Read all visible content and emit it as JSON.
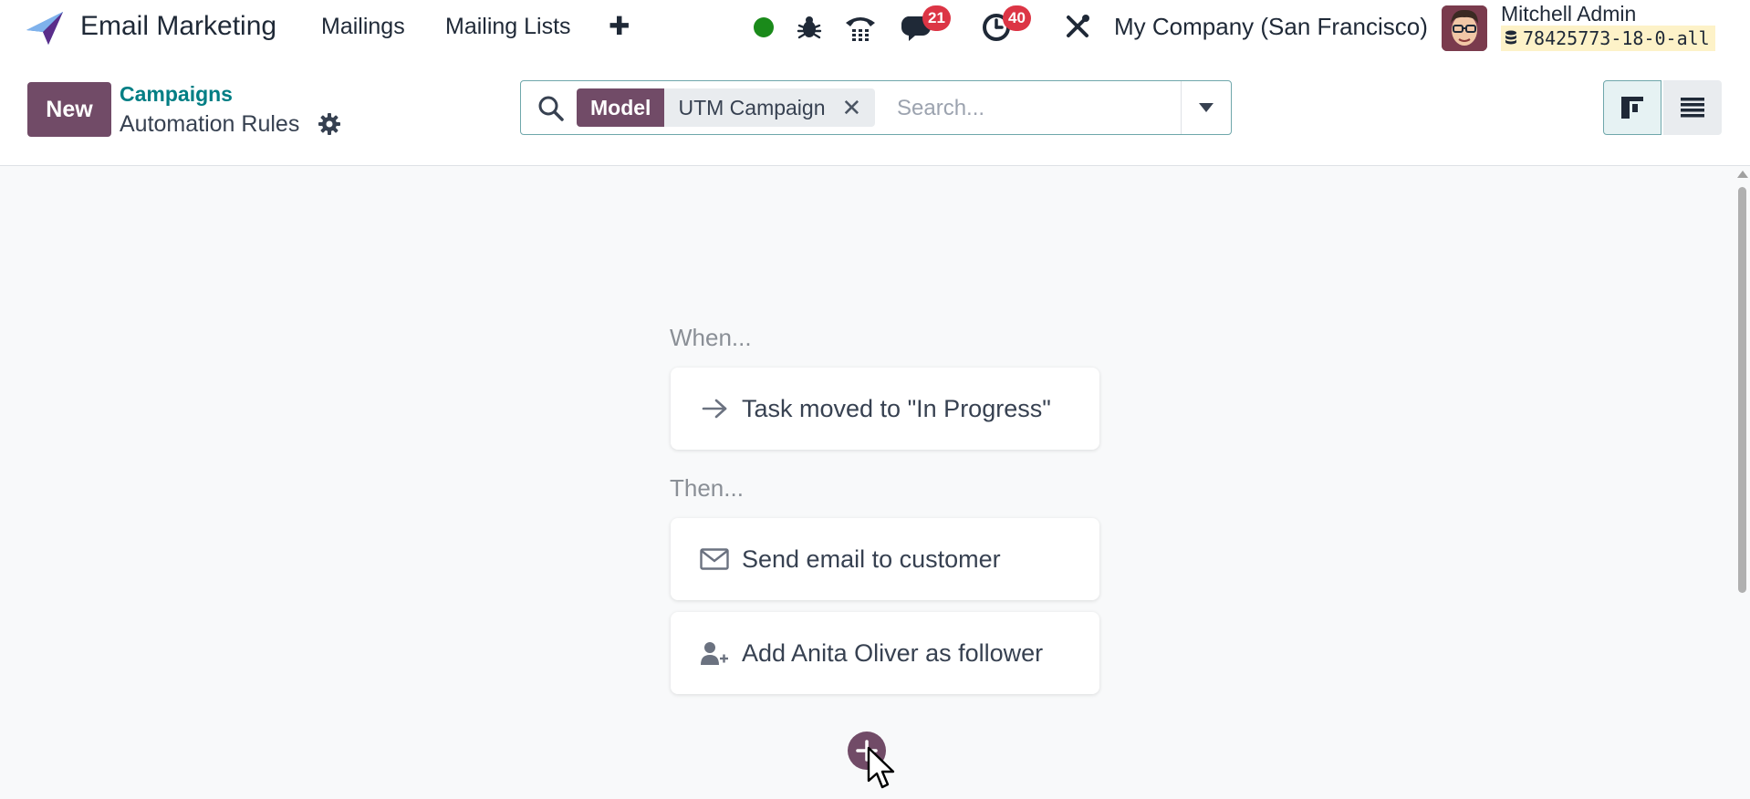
{
  "topbar": {
    "app_name": "Email Marketing",
    "menus": [
      "Mailings",
      "Mailing Lists"
    ],
    "add_symbol": "✚",
    "status_color": "#1a8a1a",
    "messages_count": "21",
    "activities_count": "40",
    "company": "My Company (San Francisco)",
    "user_name": "Mitchell Admin",
    "database": "78425773-18-0-all"
  },
  "control": {
    "new_label": "New",
    "breadcrumb_parent": "Campaigns",
    "breadcrumb_current": "Automation Rules"
  },
  "search": {
    "facet_label": "Model",
    "facet_value": "UTM Campaign",
    "facet_remove": "✕",
    "placeholder": "Search..."
  },
  "rule": {
    "when_label": "When...",
    "trigger": "Task moved to \"In Progress\"",
    "then_label": "Then...",
    "actions": [
      {
        "icon": "envelope-icon",
        "text": "Send email to customer"
      },
      {
        "icon": "user-plus-icon",
        "text": "Add Anita Oliver as follower"
      }
    ]
  },
  "colors": {
    "primary": "#714b67",
    "link": "#017e84",
    "badge": "#dc3545"
  }
}
